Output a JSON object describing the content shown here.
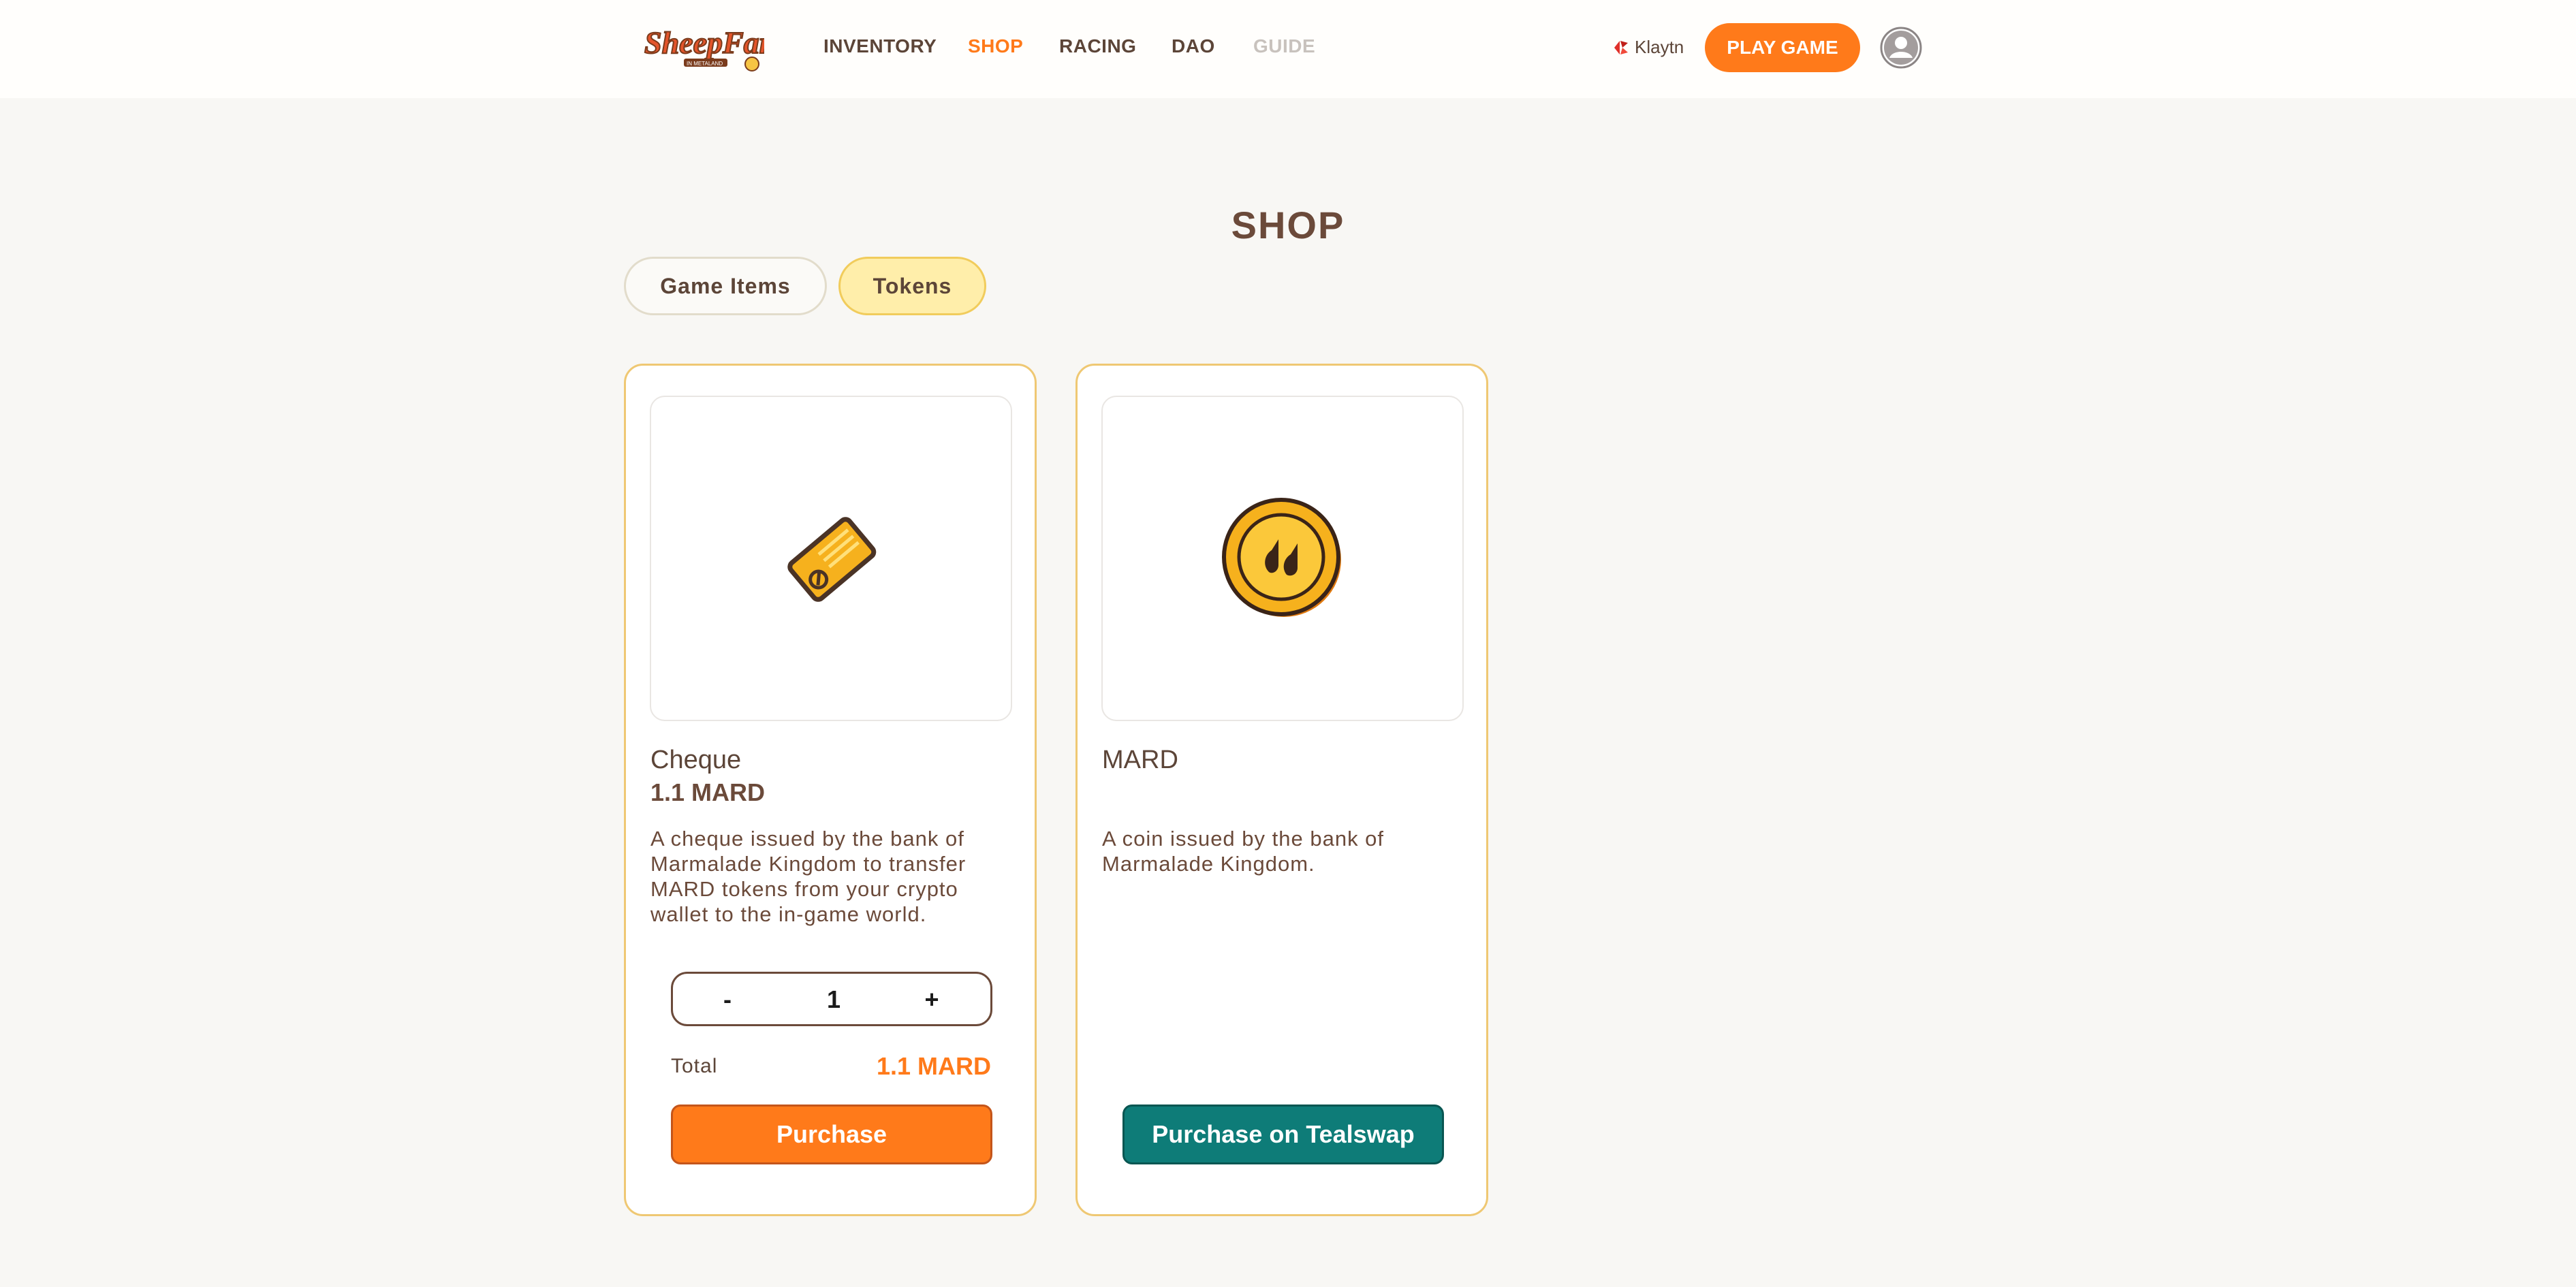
{
  "header": {
    "logo_text": "SheepFarm",
    "logo_subtext": "IN METALAND",
    "nav": [
      {
        "label": "INVENTORY",
        "state": "normal"
      },
      {
        "label": "SHOP",
        "state": "active"
      },
      {
        "label": "RACING",
        "state": "normal"
      },
      {
        "label": "DAO",
        "state": "normal"
      },
      {
        "label": "GUIDE",
        "state": "disabled"
      }
    ],
    "network": {
      "label": "Klaytn",
      "icon": "klaytn-icon"
    },
    "play_button": "PLAY GAME",
    "avatar_icon": "user-avatar-icon"
  },
  "page": {
    "title": "SHOP",
    "tabs": [
      {
        "label": "Game Items",
        "selected": false
      },
      {
        "label": "Tokens",
        "selected": true
      }
    ]
  },
  "cards": [
    {
      "name": "Cheque",
      "price": "1.1 MARD",
      "description": "A cheque issued by the bank of Marmalade Kingdom to transfer MARD tokens from your crypto wallet to the in-game world.",
      "image_icon": "cheque-icon",
      "stepper": {
        "minus": "-",
        "plus": "+",
        "value": "1"
      },
      "total_label": "Total",
      "total_value": "1.1 MARD",
      "button": "Purchase"
    },
    {
      "name": "MARD",
      "description": "A coin issued by the bank of Marmalade Kingdom.",
      "image_icon": "mard-coin-icon",
      "button": "Purchase on Tealswap"
    }
  ],
  "colors": {
    "accent": "#ff7a1a",
    "teal": "#0e7c78",
    "text": "#6b4a3a",
    "tab_selected": "#ffeeaa",
    "card_border": "#efc873"
  }
}
